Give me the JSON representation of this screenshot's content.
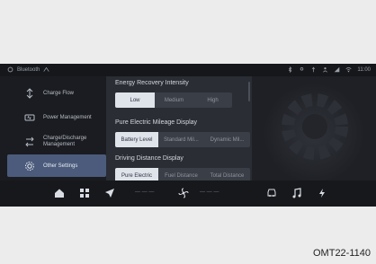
{
  "status": {
    "left_label": "Bluetooth",
    "right_time": "11:00"
  },
  "sidebar": {
    "items": [
      {
        "label": "Charge Flow",
        "icon": "charge-flow-icon",
        "active": false
      },
      {
        "label": "Power Management",
        "icon": "power-management-icon",
        "active": false
      },
      {
        "label": "Charge/Discharge Management",
        "icon": "charge-discharge-icon",
        "active": false
      },
      {
        "label": "Other Settings",
        "icon": "settings-icon",
        "active": true
      }
    ]
  },
  "content": {
    "energy_recovery": {
      "title": "Energy Recovery Intensity",
      "options": [
        "Low",
        "Medium",
        "High"
      ],
      "selected": "Low"
    },
    "mileage_display": {
      "title": "Pure Electric Mileage Display",
      "options": [
        "Battery Level",
        "Standard Mil...",
        "Dynamic Mil..."
      ],
      "selected": "Battery Level"
    },
    "driving_distance": {
      "title": "Driving Distance Display",
      "options": [
        "Pure Electric",
        "Fuel Distance",
        "Total Distance"
      ],
      "selected": "Pure Electric"
    }
  },
  "navbar": {
    "temp_left": "— — —",
    "temp_right": "— — —"
  },
  "caption": "OMT22-1140",
  "colors": {
    "screen_bg": "#1b1d22",
    "active_item": "#4c5b7b",
    "selected_option": "#dfe3ea"
  }
}
